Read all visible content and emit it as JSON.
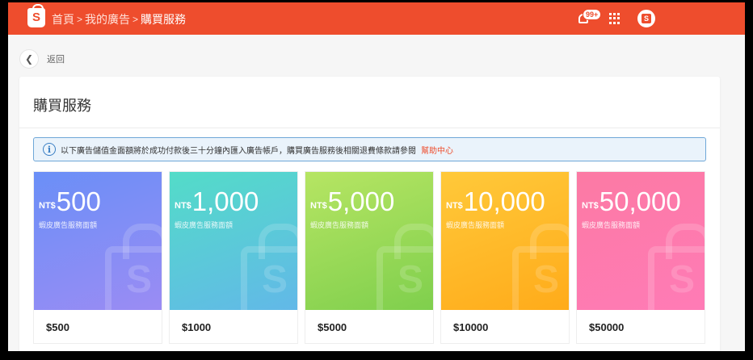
{
  "header": {
    "logo_letter": "S",
    "breadcrumb": [
      "首頁",
      "我的廣告",
      "購買服務"
    ],
    "breadcrumb_sep": ">",
    "notification_badge": "99+"
  },
  "back": {
    "label": "返回"
  },
  "panel": {
    "title": "購買服務",
    "notice_text": "以下廣告儲值金面額將於成功付款後三十分鐘內匯入廣告帳戶，購買廣告服務後相關退費條款請參閱",
    "notice_link": "幫助中心"
  },
  "cards": [
    {
      "currency": "NT$",
      "amount": "500",
      "subtitle": "蝦皮廣告服務面額",
      "price": "$500",
      "gradient": [
        "#6a8ff7",
        "#9b8cf4"
      ]
    },
    {
      "currency": "NT$",
      "amount": "1,000",
      "subtitle": "蝦皮廣告服務面額",
      "price": "$1000",
      "gradient": [
        "#53dcc8",
        "#62b8e8"
      ]
    },
    {
      "currency": "NT$",
      "amount": "5,000",
      "subtitle": "蝦皮廣告服務面額",
      "price": "$5000",
      "gradient": [
        "#b6e563",
        "#7fcf4d"
      ]
    },
    {
      "currency": "NT$",
      "amount": "10,000",
      "subtitle": "蝦皮廣告服務面額",
      "price": "$10000",
      "gradient": [
        "#ffc93a",
        "#ffab1a"
      ]
    },
    {
      "currency": "NT$",
      "amount": "50,000",
      "subtitle": "蝦皮廣告服務面額",
      "price": "$50000",
      "gradient": [
        "#fc7aa4",
        "#ff7bb6"
      ]
    }
  ],
  "colors": {
    "brand": "#ee4d2d",
    "notice_border": "#6fa7d8",
    "notice_bg": "#eaf3fb"
  }
}
